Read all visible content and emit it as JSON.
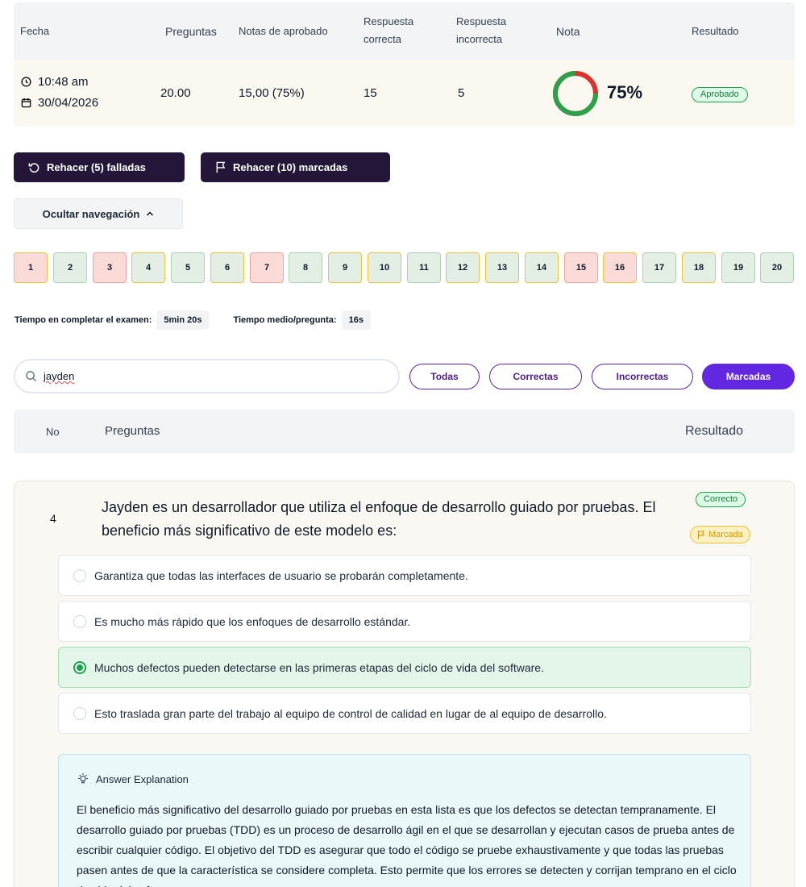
{
  "summary": {
    "headers": {
      "fecha": "Fecha",
      "preguntas": "Preguntas",
      "notas": "Notas de aprobado",
      "correcta_1": "Respuesta",
      "correcta_2": "correcta",
      "incorrecta_1": "Respuesta",
      "incorrecta_2": "incorrecta",
      "nota": "Nota",
      "resultado": "Resultado"
    },
    "time": "10:48 am",
    "date": "30/04/2026",
    "preguntas": "20.00",
    "notas": "15,00 (75%)",
    "correctas": "15",
    "incorrectas": "5",
    "nota_pct": "75%",
    "nota_fraction": 0.75,
    "resultado": "Aprobado",
    "colors": {
      "pass": "#2ea04a",
      "fail": "#d9342b"
    }
  },
  "actions": {
    "retry_failed": "Rehacer (5) falladas",
    "retry_marked": "Rehacer (10) marcadas",
    "toggle_nav": "Ocultar navegación"
  },
  "question_nav": [
    {
      "n": "1",
      "status": "wrong",
      "marked": true
    },
    {
      "n": "2",
      "status": "correct",
      "marked": false
    },
    {
      "n": "3",
      "status": "wrong",
      "marked": false
    },
    {
      "n": "4",
      "status": "correct",
      "marked": true
    },
    {
      "n": "5",
      "status": "correct",
      "marked": false
    },
    {
      "n": "6",
      "status": "correct",
      "marked": true
    },
    {
      "n": "7",
      "status": "wrong",
      "marked": false
    },
    {
      "n": "8",
      "status": "correct",
      "marked": false
    },
    {
      "n": "9",
      "status": "correct",
      "marked": true
    },
    {
      "n": "10",
      "status": "correct",
      "marked": true
    },
    {
      "n": "11",
      "status": "correct",
      "marked": false
    },
    {
      "n": "12",
      "status": "correct",
      "marked": true
    },
    {
      "n": "13",
      "status": "correct",
      "marked": true
    },
    {
      "n": "14",
      "status": "correct",
      "marked": true
    },
    {
      "n": "15",
      "status": "wrong",
      "marked": false
    },
    {
      "n": "16",
      "status": "wrong",
      "marked": true
    },
    {
      "n": "17",
      "status": "correct",
      "marked": false
    },
    {
      "n": "18",
      "status": "correct",
      "marked": true
    },
    {
      "n": "19",
      "status": "correct",
      "marked": false
    },
    {
      "n": "20",
      "status": "correct",
      "marked": false
    }
  ],
  "time_stats": {
    "total_label": "Tiempo en completar el examen:",
    "total_value": "5min 20s",
    "avg_label": "Tiempo medio/pregunta:",
    "avg_value": "16s"
  },
  "search": {
    "value": "jayden",
    "icon": "search-icon"
  },
  "filters": [
    "Todas",
    "Correctas",
    "Incorrectas",
    "Marcadas"
  ],
  "active_filter": "Marcadas",
  "list_header": {
    "no": "No",
    "preguntas": "Preguntas",
    "resultado": "Resultado"
  },
  "question": {
    "number": "4",
    "text": "Jayden es un desarrollador que utiliza el enfoque de desarrollo guiado por pruebas. El beneficio más significativo de este modelo es:",
    "result_badge": "Correcto",
    "marked_badge": "Marcada",
    "options": [
      "Garantiza que todas las interfaces de usuario se probarán completamente.",
      "Es mucho más rápido que los enfoques de desarrollo estándar.",
      "Muchos defectos pueden detectarse en las primeras etapas del ciclo de vida del software.",
      "Esto traslada gran parte del trabajo al equipo de control de calidad en lugar de al equipo de desarrollo."
    ],
    "selected_index": 2,
    "explanation_title": "Answer Explanation",
    "explanation": "El beneficio más significativo del desarrollo guiado por pruebas en esta lista es que los defectos se detectan tempranamente. El desarrollo guiado por pruebas (TDD) es un proceso de desarrollo ágil en el que se desarrollan y ejecutan casos de prueba antes de escribir cualquier código. El objetivo del TDD es asegurar que todo el código se pruebe exhaustivamente y que todas las pruebas pasen antes de que la característica se considere completa. Esto permite que los errores se detecten y corrijan temprano en el ciclo de vida del software."
  }
}
